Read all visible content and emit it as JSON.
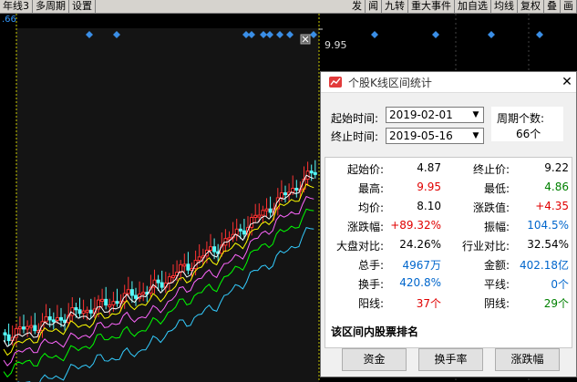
{
  "toolbar": {
    "left": [
      "年线3",
      "多周期",
      "设置"
    ],
    "right": [
      "发",
      "闻",
      "九转",
      "重大事件",
      "加自选",
      "均线",
      "复权",
      "叠",
      "画"
    ]
  },
  "indicator_value": ".66",
  "chart": {
    "price_label": "9.95",
    "colors": {
      "up": "#ff3232",
      "down": "#54fcfc",
      "bg": "#000000"
    }
  },
  "dialog": {
    "title": "个股K线区间统计",
    "start_label": "起始时间:",
    "start_date": "2019-02-01",
    "end_label": "终止时间:",
    "end_date": "2019-05-16",
    "period_label": "周期个数:",
    "period_count": "66个",
    "stats": [
      {
        "l1": "起始价:",
        "v1": "4.87",
        "c1": "black",
        "l2": "终止价:",
        "v2": "9.22",
        "c2": "black"
      },
      {
        "l1": "最高:",
        "v1": "9.95",
        "c1": "red",
        "l2": "最低:",
        "v2": "4.86",
        "c2": "green"
      },
      {
        "l1": "均价:",
        "v1": "8.10",
        "c1": "black",
        "l2": "涨跌值:",
        "v2": "+4.35",
        "c2": "red"
      },
      {
        "l1": "涨跌幅:",
        "v1": "+89.32%",
        "c1": "red",
        "l2": "振幅:",
        "v2": "104.5%",
        "c2": "blue"
      },
      {
        "l1": "大盘对比:",
        "v1": "24.26%",
        "c1": "black",
        "l2": "行业对比:",
        "v2": "32.54%",
        "c2": "black"
      },
      {
        "l1": "总手:",
        "v1": "4967万",
        "c1": "blue",
        "l2": "金额:",
        "v2": "402.18亿",
        "c2": "blue"
      },
      {
        "l1": "换手:",
        "v1": "420.8%",
        "c1": "blue",
        "l2": "平线:",
        "v2": "0个",
        "c2": "blue"
      },
      {
        "l1": "阳线:",
        "v1": "37个",
        "c1": "red",
        "l2": "阴线:",
        "v2": "29个",
        "c2": "green"
      }
    ],
    "rank_label": "该区间内股票排名",
    "buttons": [
      "资金",
      "换手率",
      "涨跌幅"
    ]
  }
}
